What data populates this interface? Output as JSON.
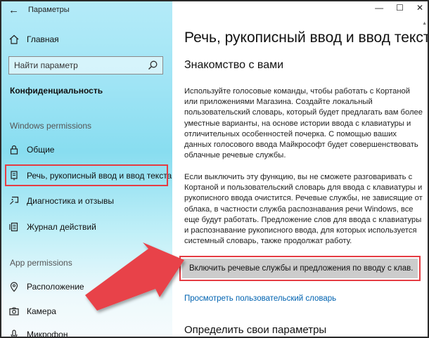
{
  "window": {
    "title": "Параметры",
    "controls": {
      "minimize": "—",
      "maximize": "☐",
      "close": "✕"
    }
  },
  "sidebar": {
    "home_label": "Главная",
    "search_placeholder": "Найти параметр",
    "category": "Конфиденциальность",
    "windows_permissions_title": "Windows permissions",
    "items": [
      {
        "label": "Общие",
        "icon": "lock-icon"
      },
      {
        "label": "Речь, рукописный ввод и ввод текста",
        "icon": "speech-icon"
      },
      {
        "label": "Диагностика и отзывы",
        "icon": "feedback-icon"
      },
      {
        "label": "Журнал действий",
        "icon": "activity-icon"
      }
    ],
    "app_permissions_title": "App permissions",
    "app_items": [
      {
        "label": "Расположение",
        "icon": "location-icon"
      },
      {
        "label": "Камера",
        "icon": "camera-icon"
      },
      {
        "label": "Микрофон",
        "icon": "microphone-icon"
      }
    ]
  },
  "main": {
    "page_title": "Речь, рукописный ввод и ввод текста",
    "section_heading": "Знакомство с вами",
    "paragraph1": "Используйте голосовые команды, чтобы работать с Кортаной или приложениями Магазина. Создайте локальный пользовательский словарь, который будет предлагать вам более уместные варианты, на основе истории ввода с клавиатуры и отличительных особенностей почерка. С помощью ваших данных голосового ввода Майкрософт будет совершенствовать облачные речевые службы.",
    "paragraph2": "Если выключить эту функцию, вы не сможете разговаривать с Кортаной и пользовательский словарь для ввода с клавиатуры и рукописного ввода очистится. Речевые службы, не зависящие от облака, в частности служба распознавания речи Windows, все еще будут работать. Предложение слов для ввода с клавиатуры и распознавание рукописного ввода, для которых используется системный словарь, также продолжат работу.",
    "toggle_button": "Включить речевые службы и предложения по вводу с клав.",
    "dictionary_link": "Просмотреть пользовательский словарь",
    "define_heading": "Определить свои параметры"
  },
  "colors": {
    "highlight": "#e53c43",
    "link": "#0063b1",
    "button_bg": "#cccccc"
  }
}
